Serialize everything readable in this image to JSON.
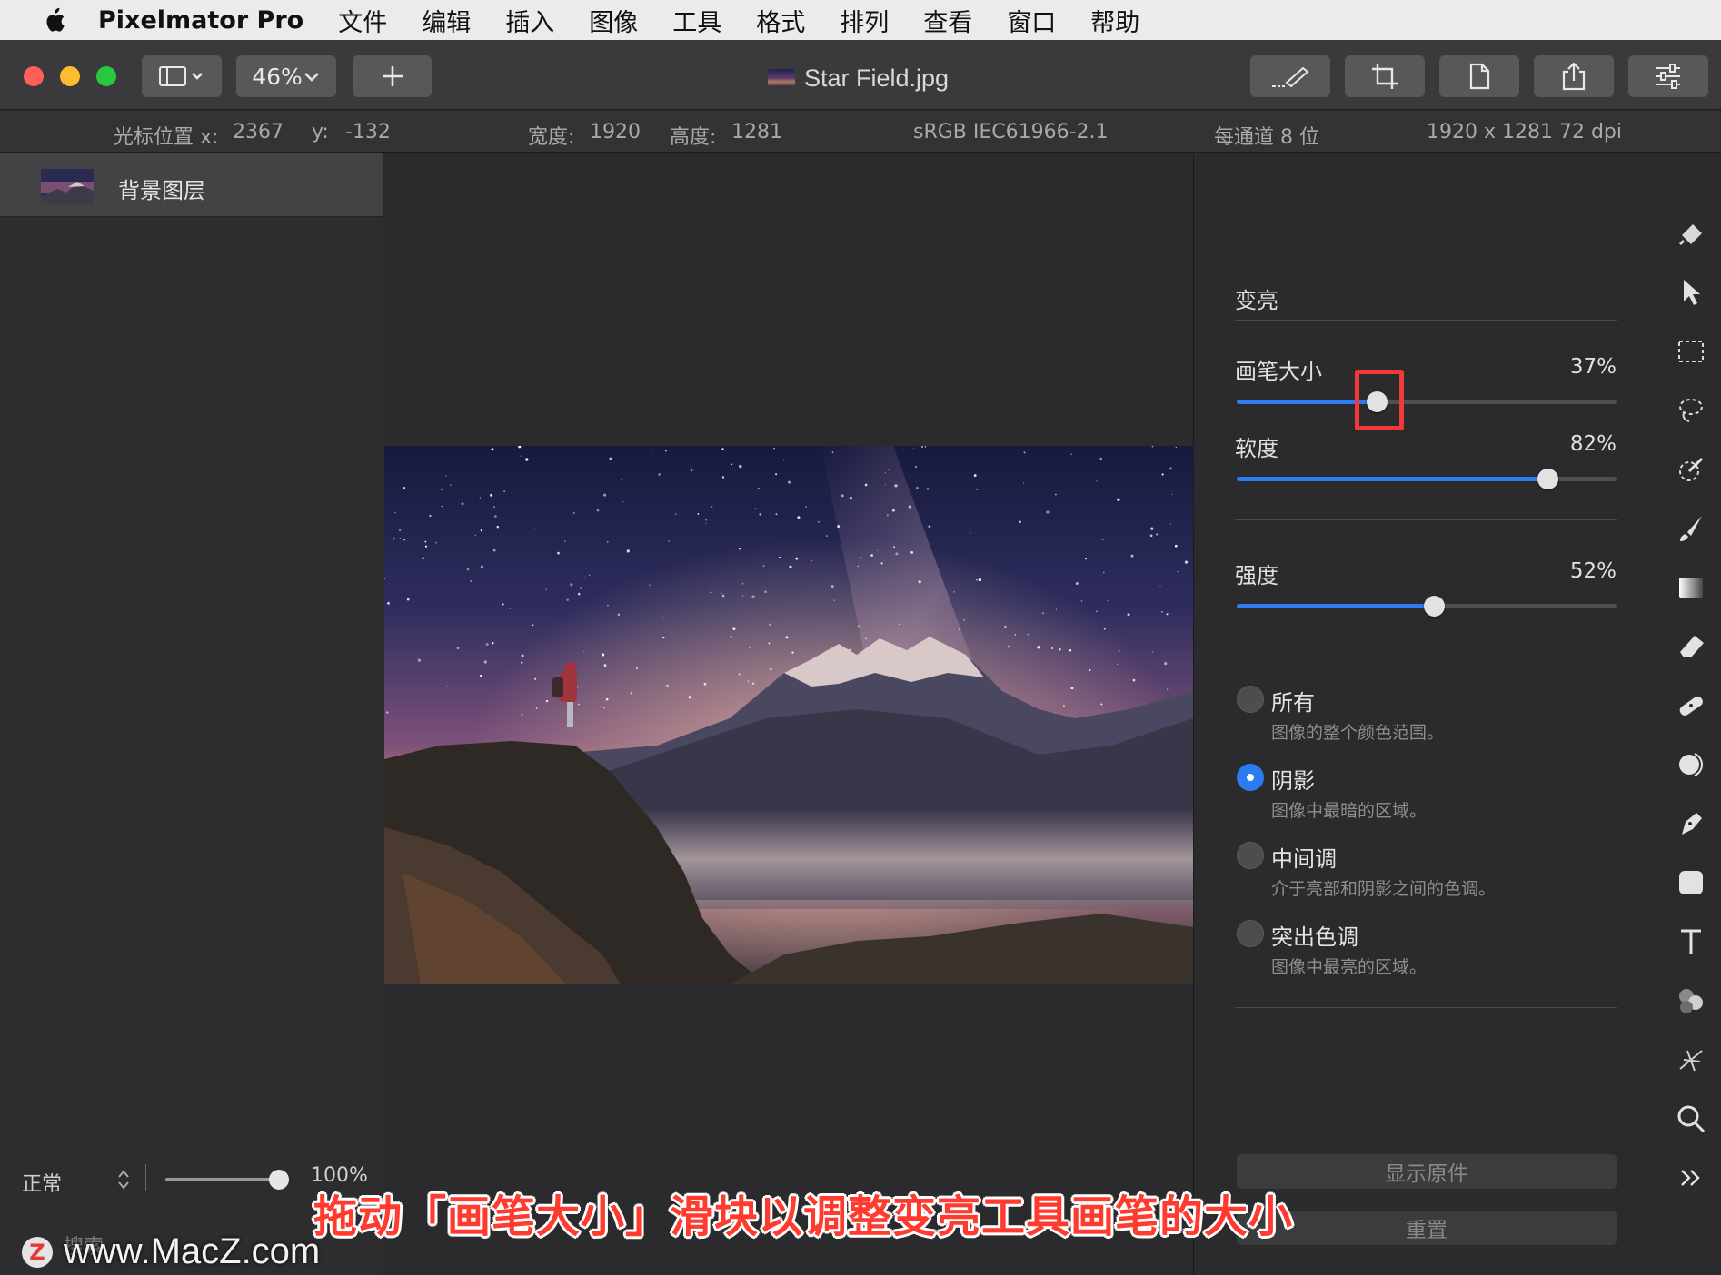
{
  "menubar": {
    "app_name": "Pixelmator Pro",
    "items": [
      "文件",
      "编辑",
      "插入",
      "图像",
      "工具",
      "格式",
      "排列",
      "查看",
      "窗口",
      "帮助"
    ]
  },
  "toolbar": {
    "zoom": "46%",
    "document_title": "Star Field.jpg",
    "icons": [
      "sidebar-toggle-icon",
      "plus-icon",
      "paint-brush-icon",
      "crop-icon",
      "document-icon",
      "share-icon",
      "sliders-icon"
    ]
  },
  "infobar": {
    "cursor_x_label": "光标位置 x:",
    "cursor_x": "2367",
    "cursor_y_label": "y:",
    "cursor_y": "-132",
    "width_label": "宽度:",
    "width": "1920",
    "height_label": "高度:",
    "height": "1281",
    "color_profile": "sRGB IEC61966-2.1",
    "bit_depth": "每通道 8 位",
    "resolution": "1920 x 1281 72 dpi"
  },
  "layers": {
    "items": [
      {
        "name": "背景图层"
      }
    ],
    "blend_mode": "正常",
    "opacity": "100%",
    "opacity_fraction": 1.0,
    "search_placeholder": "搜索"
  },
  "panel": {
    "title": "变亮",
    "brush_size": {
      "label": "画笔大小",
      "value": "37%",
      "fraction": 0.37
    },
    "softness": {
      "label": "软度",
      "value": "82%",
      "fraction": 0.82
    },
    "strength": {
      "label": "强度",
      "value": "52%",
      "fraction": 0.52
    },
    "ranges": [
      {
        "title": "所有",
        "desc": "图像的整个颜色范围。",
        "selected": false
      },
      {
        "title": "阴影",
        "desc": "图像中最暗的区域。",
        "selected": true
      },
      {
        "title": "中间调",
        "desc": "介于亮部和阴影之间的色调。",
        "selected": false
      },
      {
        "title": "突出色调",
        "desc": "图像中最亮的区域。",
        "selected": false
      }
    ],
    "show_original": "显示原件",
    "reset": "重置"
  },
  "tools": [
    "paint-bucket-icon",
    "arrow-pointer-icon",
    "rect-select-icon",
    "lasso-icon",
    "magic-wand-icon",
    "brush-icon",
    "gradient-icon",
    "eraser-icon",
    "bandage-icon",
    "color-adjust-icon",
    "pen-icon",
    "shape-icon",
    "type-icon",
    "effects-icon",
    "distort-icon",
    "zoom-icon",
    "more-icon"
  ],
  "colors": {
    "accent": "#2c7bf0",
    "highlight": "#f03a3a",
    "caption": "#ff3b30"
  },
  "caption": "拖动「画笔大小」滑块以调整变亮工具画笔的大小",
  "watermark": "www.MacZ.com"
}
